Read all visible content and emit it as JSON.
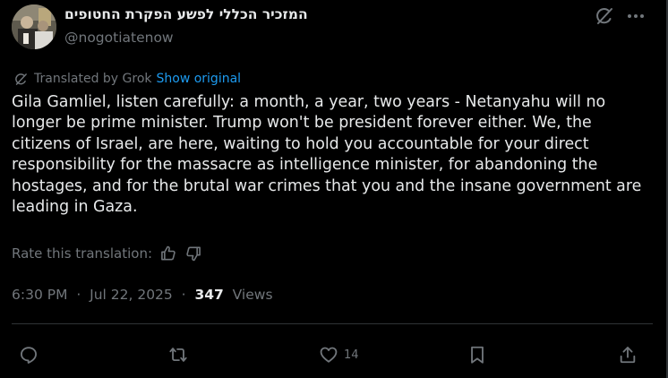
{
  "author": {
    "display_name": "המזכיר הכללי לפשע הפקרת החטופים",
    "handle": "@nogotiatenow"
  },
  "header_icons": [
    "grok-icon",
    "more-icon"
  ],
  "translation": {
    "label": "Translated by Grok",
    "show_original": "Show original"
  },
  "tweet": {
    "text": "Gila Gamliel, listen carefully: a month, a year, two years - Netanyahu will no longer be prime minister. Trump won't be president forever either. We, the citizens of Israel, are here, waiting to hold you accountable for your direct responsibility for the massacre as intelligence minister, for abandoning the hostages, and for the brutal war crimes that you and the insane government are leading in Gaza."
  },
  "rating": {
    "label": "Rate this translation:"
  },
  "meta": {
    "time": "6:30 PM",
    "separator": "·",
    "date": "Jul 22, 2025",
    "views_count": "347",
    "views_label": "Views"
  },
  "actions": {
    "likes": "14"
  },
  "colors": {
    "background": "#000000",
    "text_primary": "#e7e9ea",
    "text_secondary": "#71767b",
    "link": "#1d9bf0",
    "border": "#2f3336"
  }
}
